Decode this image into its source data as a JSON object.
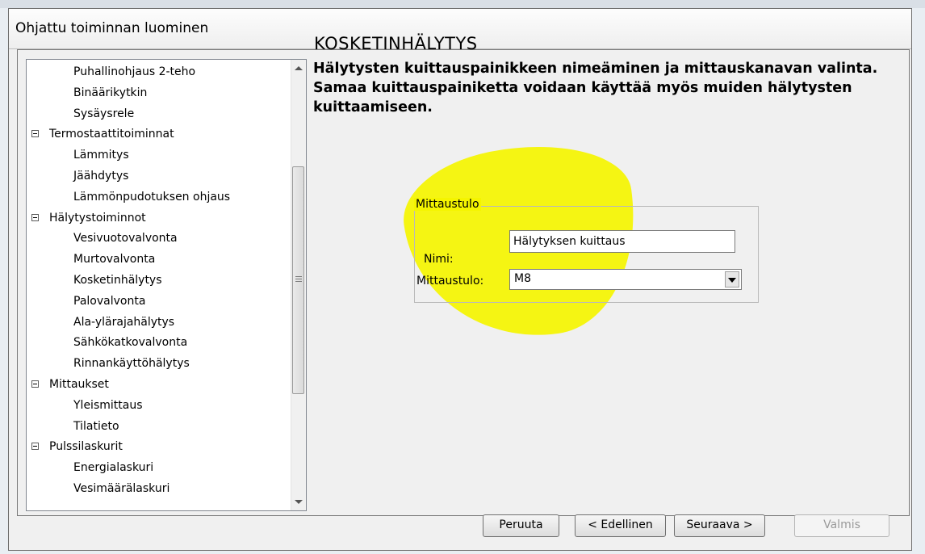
{
  "window": {
    "title": "Ohjattu toiminnan luominen"
  },
  "tree": {
    "items": [
      {
        "label": "Puhallinohjaus 2-teho",
        "type": "leaf"
      },
      {
        "label": "Binäärikytkin",
        "type": "leaf"
      },
      {
        "label": "Sysäysrele",
        "type": "leaf"
      },
      {
        "label": "Termostaattitoiminnat",
        "type": "group"
      },
      {
        "label": "Lämmitys",
        "type": "leaf"
      },
      {
        "label": "Jäähdytys",
        "type": "leaf"
      },
      {
        "label": "Lämmönpudotuksen ohjaus",
        "type": "leaf"
      },
      {
        "label": "Hälytystoiminnot",
        "type": "group"
      },
      {
        "label": "Vesivuotovalvonta",
        "type": "leaf"
      },
      {
        "label": "Murtovalvonta",
        "type": "leaf"
      },
      {
        "label": "Kosketinhälytys",
        "type": "leaf"
      },
      {
        "label": "Palovalvonta",
        "type": "leaf"
      },
      {
        "label": "Ala-ylärajahälytys",
        "type": "leaf"
      },
      {
        "label": "Sähkökatkovalvonta",
        "type": "leaf"
      },
      {
        "label": "Rinnankäyttöhälytys",
        "type": "leaf"
      },
      {
        "label": "Mittaukset",
        "type": "group"
      },
      {
        "label": "Yleismittaus",
        "type": "leaf"
      },
      {
        "label": "Tilatieto",
        "type": "leaf"
      },
      {
        "label": "Pulssilaskurit",
        "type": "group"
      },
      {
        "label": "Energialaskuri",
        "type": "leaf"
      },
      {
        "label": "Vesimäärälaskuri",
        "type": "leaf"
      }
    ]
  },
  "panel": {
    "title": "KOSKETINHÄLYTYS",
    "description": "Hälytysten kuittauspainikkeen nimeäminen ja mittauskanavan valinta. Samaa kuittauspainiketta voidaan käyttää myös muiden hälytysten kuittaamiseen.",
    "groupbox_label": "Mittaustulo",
    "name_label": "Nimi:",
    "name_value": "Hälytyksen kuittaus",
    "channel_label": "Mittaustulo:",
    "channel_value": "M8",
    "highlight_color": "#f5f500"
  },
  "buttons": {
    "cancel": "Peruuta",
    "previous": "< Edellinen",
    "next": "Seuraava >",
    "finish": "Valmis"
  }
}
